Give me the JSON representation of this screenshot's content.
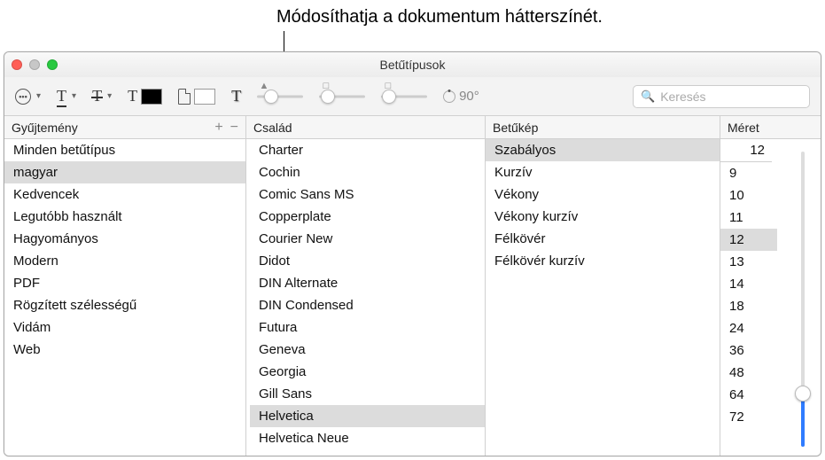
{
  "callout": "Módosíthatja a dokumentum hátterszínét.",
  "window_title": "Betűtípusok",
  "toolbar": {
    "rotate_value": "90°",
    "search_placeholder": "Keresés"
  },
  "columns": {
    "collection": {
      "header": "Gyűjtemény",
      "items": [
        "Minden betűtípus",
        "magyar",
        "Kedvencek",
        "Legutóbb használt",
        "Hagyományos",
        "Modern",
        "PDF",
        "Rögzített szélességű",
        "Vidám",
        "Web"
      ],
      "selected": "magyar"
    },
    "family": {
      "header": "Család",
      "items": [
        "Charter",
        "Cochin",
        "Comic Sans MS",
        "Copperplate",
        "Courier New",
        "Didot",
        "DIN Alternate",
        "DIN Condensed",
        "Futura",
        "Geneva",
        "Georgia",
        "Gill Sans",
        "Helvetica",
        "Helvetica Neue"
      ],
      "selected": "Helvetica"
    },
    "typeface": {
      "header": "Betűkép",
      "items": [
        "Szabályos",
        "Kurzív",
        "Vékony",
        "Vékony kurzív",
        "Félkövér",
        "Félkövér kurzív"
      ],
      "selected": "Szabályos"
    },
    "size": {
      "header": "Méret",
      "value": "12",
      "items": [
        "9",
        "10",
        "11",
        "12",
        "13",
        "14",
        "18",
        "24",
        "36",
        "48",
        "64",
        "72"
      ],
      "selected": "12"
    }
  }
}
